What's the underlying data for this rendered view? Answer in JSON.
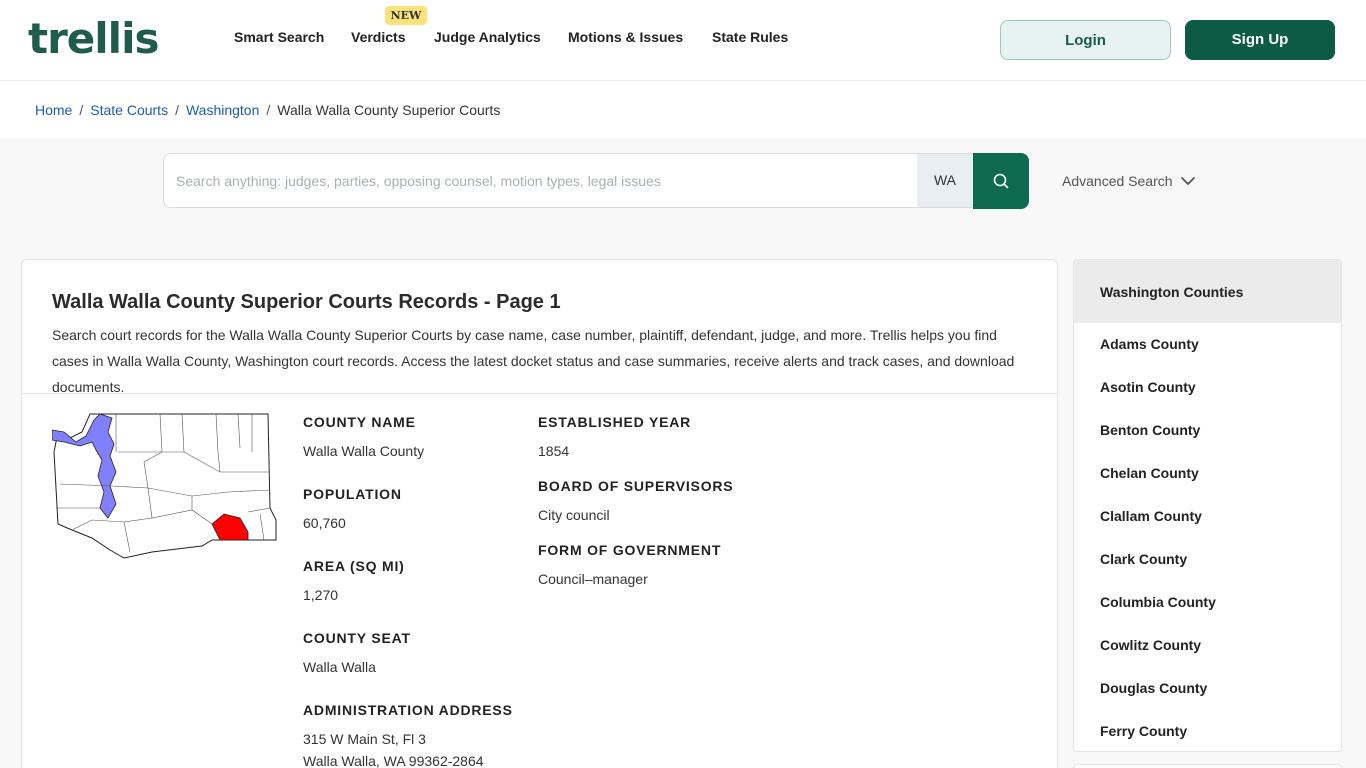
{
  "header": {
    "logo": "trellis",
    "nav": [
      {
        "label": "Smart Search"
      },
      {
        "label": "Verdicts",
        "badge": "NEW"
      },
      {
        "label": "Judge Analytics"
      },
      {
        "label": "Motions & Issues"
      },
      {
        "label": "State Rules"
      }
    ],
    "login_label": "Login",
    "signup_label": "Sign Up"
  },
  "breadcrumb": {
    "items": [
      "Home",
      "State Courts",
      "Washington"
    ],
    "current": "Walla Walla County Superior Courts"
  },
  "search": {
    "placeholder": "Search anything: judges, parties, opposing counsel, motion types, legal issues",
    "value": "",
    "state": "WA",
    "advanced_label": "Advanced Search"
  },
  "main": {
    "title": "Walla Walla County Superior Courts Records - Page 1",
    "description": "Search court records for the Walla Walla County Superior Courts by case name, case number, plaintiff, defendant, judge, and more. Trellis helps you find cases in Walla Walla County, Washington court records. Access the latest docket status and case summaries, receive alerts and track cases, and download documents.",
    "fields": {
      "county_name_label": "COUNTY NAME",
      "county_name": "Walla Walla County",
      "population_label": "POPULATION",
      "population": "60,760",
      "area_label": "AREA (SQ MI)",
      "area": "1,270",
      "county_seat_label": "COUNTY SEAT",
      "county_seat": "Walla Walla",
      "address_label": "ADMINISTRATION ADDRESS",
      "address_line1": "315 W Main St, Fl 3",
      "address_line2": "Walla Walla, WA 99362-2864",
      "established_label": "ESTABLISHED YEAR",
      "established": "1854",
      "board_label": "BOARD OF SUPERVISORS",
      "board": "City council",
      "government_label": "FORM OF GOVERNMENT",
      "government": "Council–manager"
    }
  },
  "sidebar": {
    "title": "Washington Counties",
    "counties": [
      "Adams County",
      "Asotin County",
      "Benton County",
      "Chelan County",
      "Clallam County",
      "Clark County",
      "Columbia County",
      "Cowlitz County",
      "Douglas County",
      "Ferry County"
    ]
  },
  "colors": {
    "brand_green": "#0d5a45",
    "link_blue": "#1e5cae",
    "highlight_red": "#ff0000",
    "water_blue": "#8080ff",
    "badge_yellow": "#fbe27a"
  }
}
